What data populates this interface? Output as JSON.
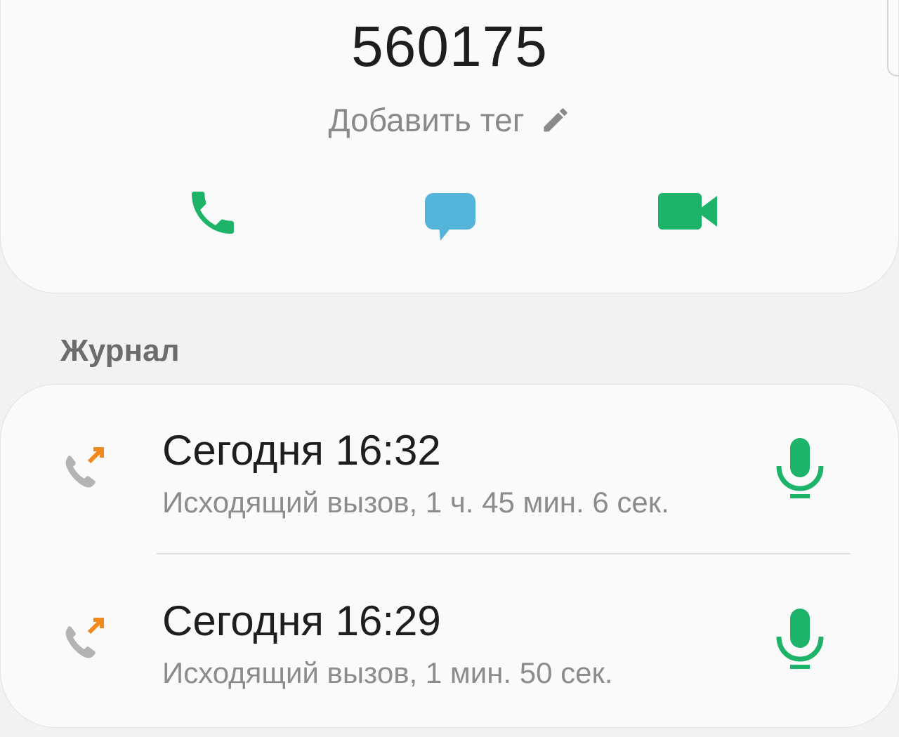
{
  "contact": {
    "number": "560175",
    "add_tag_label": "Добавить тег"
  },
  "actions": [
    {
      "name": "call",
      "icon": "phone-icon",
      "color": "#1db46a"
    },
    {
      "name": "message",
      "icon": "chat-bubble-icon",
      "color": "#54b4d9"
    },
    {
      "name": "video",
      "icon": "video-camera-icon",
      "color": "#1db46a"
    }
  ],
  "log": {
    "title": "Журнал",
    "entries": [
      {
        "time": "Сегодня 16:32",
        "detail": "Исходящий вызов, 1 ч. 45 мин. 6 сек.",
        "type_icon": "outgoing-call-icon",
        "recording_icon": "microphone-icon"
      },
      {
        "time": "Сегодня 16:29",
        "detail": "Исходящий вызов, 1 мин. 50 сек.",
        "type_icon": "outgoing-call-icon",
        "recording_icon": "microphone-icon"
      }
    ]
  },
  "colors": {
    "accent_green": "#1db46a",
    "message_blue": "#54b4d9",
    "outgoing_arrow": "#f08a1d",
    "muted_text": "#8c8c8c"
  }
}
